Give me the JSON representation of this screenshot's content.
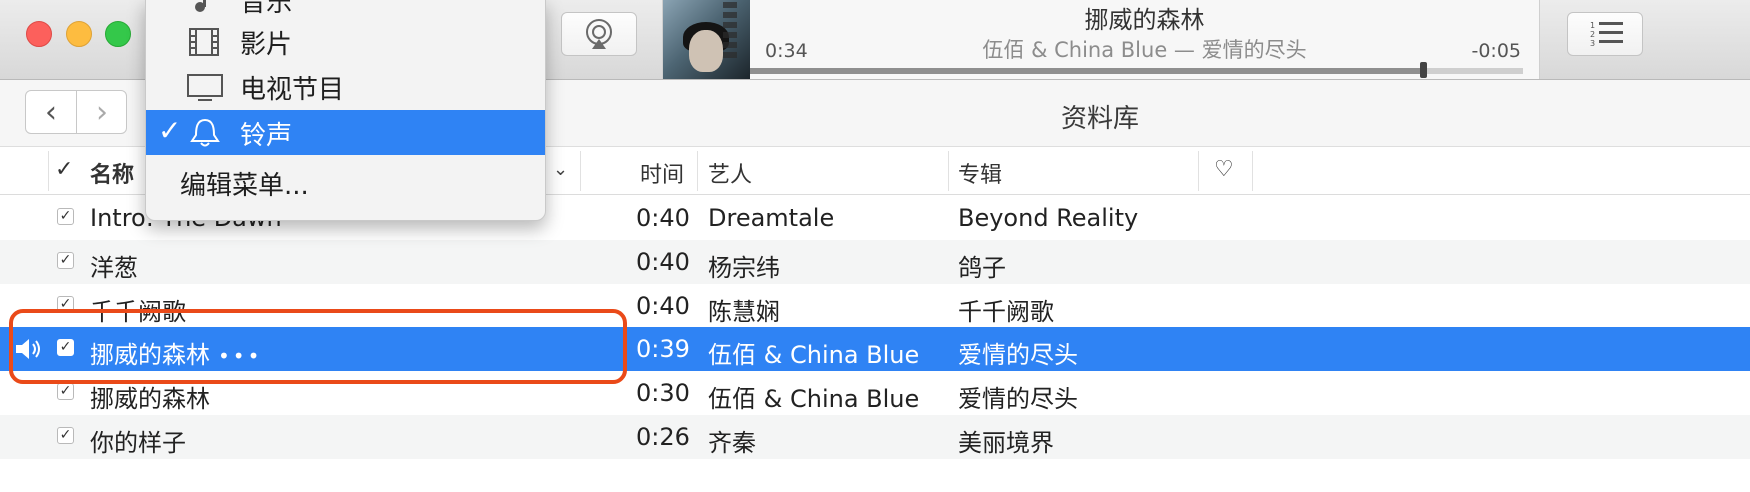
{
  "window": {
    "title": "资料库"
  },
  "lcd": {
    "song_title": "挪威的森林",
    "subtitle": "伍佰 & China Blue — 爱情的尽头",
    "elapsed": "0:34",
    "remaining": "-0:05",
    "progress_fraction": 0.87
  },
  "menu": {
    "items": [
      {
        "label": "音乐",
        "icon": "music-note-icon",
        "checked": false
      },
      {
        "label": "影片",
        "icon": "film-icon",
        "checked": false
      },
      {
        "label": "电视节目",
        "icon": "tv-icon",
        "checked": false
      },
      {
        "label": "铃声",
        "icon": "bell-icon",
        "checked": true
      },
      {
        "label": "编辑菜单..."
      }
    ]
  },
  "table": {
    "headers": {
      "check": "✓",
      "name": "名称",
      "time": "时间",
      "artist": "艺人",
      "album": "专辑",
      "love": "♡"
    },
    "rows": [
      {
        "checked": "✓",
        "name": "Intro: The Dawn",
        "time": "0:40",
        "artist": "Dreamtale",
        "album": "Beyond Reality"
      },
      {
        "checked": "✓",
        "name": "洋葱",
        "time": "0:40",
        "artist": "杨宗纬",
        "album": "鸽子"
      },
      {
        "checked": "✓",
        "name": "千千阙歌",
        "time": "0:40",
        "artist": "陈慧娴",
        "album": "千千阙歌"
      },
      {
        "checked": "✓",
        "name": "挪威的森林",
        "more": "•••",
        "time": "0:39",
        "artist": "伍佰 & China Blue",
        "album": "爱情的尽头",
        "playing": true,
        "selected": true
      },
      {
        "checked": "✓",
        "name": "挪威的森林",
        "time": "0:30",
        "artist": "伍佰 & China Blue",
        "album": "爱情的尽头"
      },
      {
        "checked": "✓",
        "name": "你的样子",
        "time": "0:26",
        "artist": "齐秦",
        "album": "美丽境界"
      }
    ]
  },
  "colors": {
    "selection": "#2f83f4",
    "highlight_ring": "#ea4a19"
  }
}
